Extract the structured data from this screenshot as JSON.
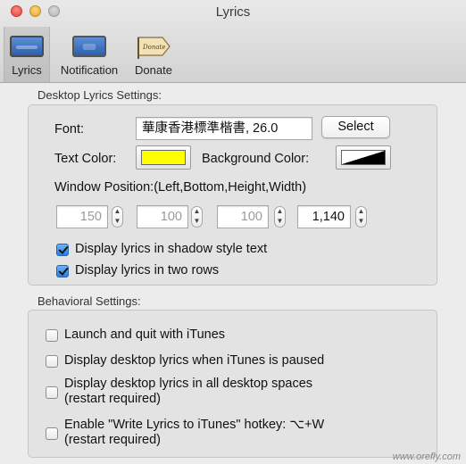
{
  "window": {
    "title": "Lyrics"
  },
  "toolbar": {
    "items": [
      {
        "label": "Lyrics",
        "icon": "lyrics-display-icon",
        "selected": true
      },
      {
        "label": "Notification",
        "icon": "notification-display-icon",
        "selected": false
      },
      {
        "label": "Donate",
        "icon": "donate-sign-icon",
        "selected": false,
        "icon_text": "Donate"
      }
    ]
  },
  "desktop": {
    "section_title": "Desktop Lyrics Settings:",
    "font_label": "Font:",
    "font_value": "華康香港標準楷書, 26.0",
    "select_button": "Select",
    "text_color_label": "Text Color:",
    "text_color": "#ffff00",
    "background_color_label": "Background Color:",
    "background_color": "#000000",
    "window_position_label": "Window Position:(Left,Bottom,Height,Width)",
    "position": {
      "left": "150",
      "bottom": "100",
      "height": "100",
      "width": "1,140"
    },
    "shadow_label": "Display lyrics in shadow style text",
    "shadow_checked": true,
    "two_rows_label": "Display lyrics in two rows",
    "two_rows_checked": true
  },
  "behavioral": {
    "section_title": "Behavioral Settings:",
    "launch_label": "Launch and quit with iTunes",
    "paused_label": "Display desktop lyrics when iTunes is paused",
    "spaces_line1": "Display desktop lyrics in all desktop spaces",
    "spaces_line2": "(restart required)",
    "hotkey_line1": "Enable \"Write Lyrics to iTunes\" hotkey: ⌥+W",
    "hotkey_line2": "(restart required)"
  },
  "watermark": "www.orefly.com",
  "colors": {
    "checkbox_on": "#2d7fe0",
    "toolbar_top": "#e9e9e9",
    "window_bg": "#ececec"
  }
}
